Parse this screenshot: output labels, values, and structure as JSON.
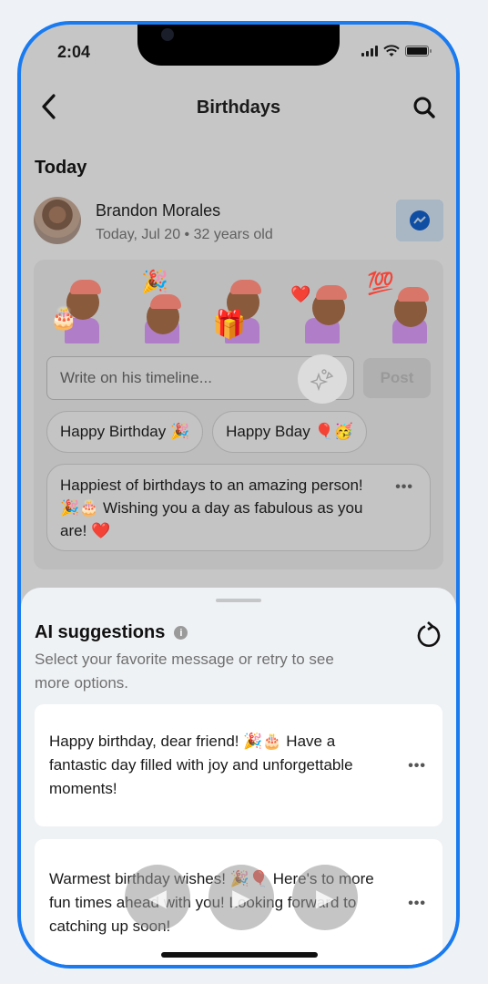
{
  "status_bar": {
    "time": "2:04",
    "battery_level": 1.0
  },
  "nav": {
    "title": "Birthdays",
    "back_icon": "chevron-left-icon",
    "search_icon": "search-icon"
  },
  "section": {
    "title": "Today"
  },
  "person": {
    "name": "Brandon Morales",
    "meta": "Today, Jul 20 • 32 years old",
    "action_icon": "messenger-icon"
  },
  "stickers": [
    {
      "name": "birthday-cake-sticker",
      "prop": "🎂"
    },
    {
      "name": "happy-birthday-sticker",
      "prop": "🎉"
    },
    {
      "name": "gift-sticker",
      "prop": "🎁"
    },
    {
      "name": "heart-kiss-sticker",
      "prop": "❤️"
    },
    {
      "name": "hundred-sticker",
      "prop": "💯"
    }
  ],
  "composer": {
    "placeholder": "Write on his timeline...",
    "ai_icon": "sparkle-icon",
    "post_label": "Post"
  },
  "quick_replies": [
    "Happy Birthday 🎉",
    "Happy Bday 🎈🥳"
  ],
  "long_reply": "Happiest of birthdays to an amazing person! 🎉🎂 Wishing you a day as fabulous as you are! ❤️",
  "more_label": "•••",
  "ai_sheet": {
    "title": "AI suggestions",
    "info_icon": "i",
    "subtitle": "Select your favorite message or retry to see more options.",
    "suggestions": [
      "Happy birthday, dear friend! 🎉🎂 Have a fantastic day filled with joy and unforgettable moments!",
      "Warmest birthday wishes! 🎉🎈 Here's to more fun times ahead with you! Looking forward to catching up soon!"
    ]
  },
  "media_controls": {
    "prev": "◀",
    "play": "▶",
    "next": "▶"
  },
  "colors": {
    "frame": "#1a7bf0",
    "messenger": "#0f4ea3"
  }
}
